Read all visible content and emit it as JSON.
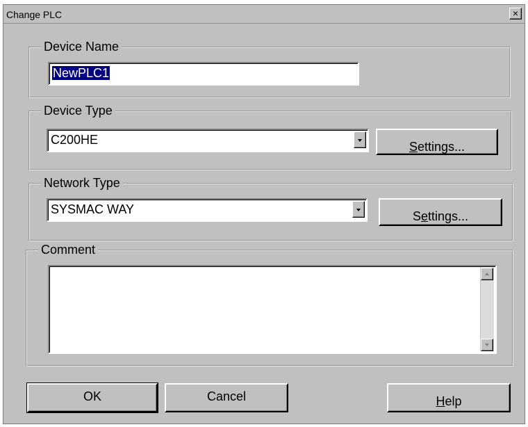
{
  "dialog": {
    "title": "Change PLC",
    "close_glyph": "×"
  },
  "device_name": {
    "label": "Device Name",
    "value": "NewPLC1"
  },
  "device_type": {
    "label": "Device Type",
    "value": "C200HE",
    "settings_pre": "",
    "settings_mnemonic": "S",
    "settings_post": "ettings..."
  },
  "network_type": {
    "label": "Network Type",
    "value": "SYSMAC WAY",
    "settings_pre": "S",
    "settings_mnemonic": "e",
    "settings_post": "ttings..."
  },
  "comment": {
    "label": "Comment",
    "value": ""
  },
  "buttons": {
    "ok": "OK",
    "cancel": "Cancel",
    "help_mnemonic": "H",
    "help_post": "elp"
  },
  "colors": {
    "dialog_bg": "#c0c0c0",
    "selection": "#000080"
  },
  "icons": {
    "close": "close-icon",
    "dropdown": "chevron-down-icon",
    "scroll_up": "scroll-up-icon",
    "scroll_down": "scroll-down-icon"
  }
}
